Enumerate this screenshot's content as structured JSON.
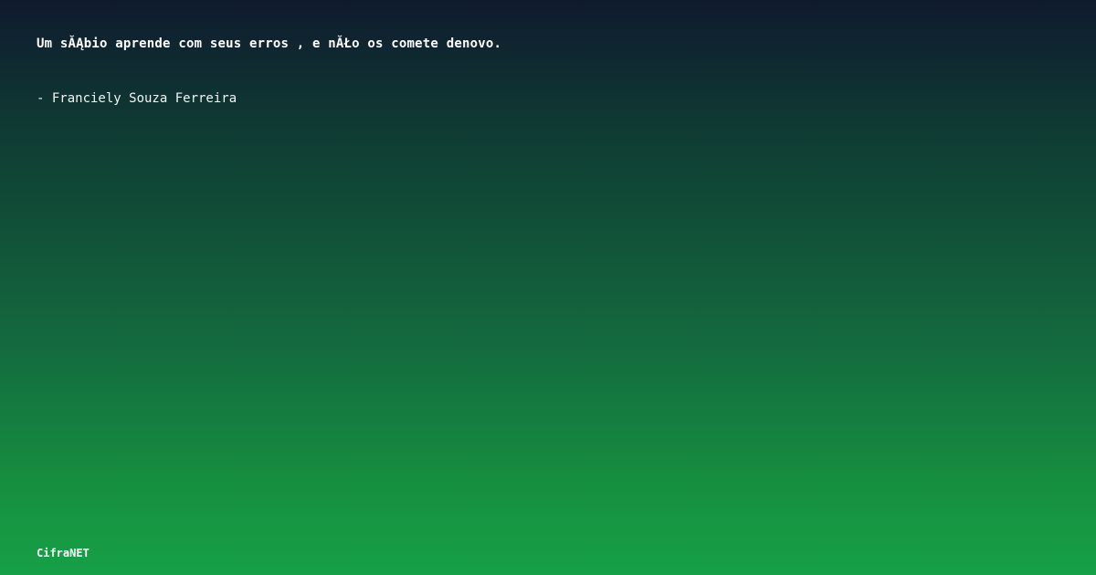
{
  "quote": {
    "text": "Um sĂĄbio aprende com seus erros , e nĂŁo os comete denovo.",
    "author": "- Franciely Souza Ferreira"
  },
  "footer": {
    "brand": "CifraNET"
  },
  "colors": {
    "text": "#ffffff",
    "gradient_top": "#0f1a2e",
    "gradient_bottom": "#16a047"
  }
}
